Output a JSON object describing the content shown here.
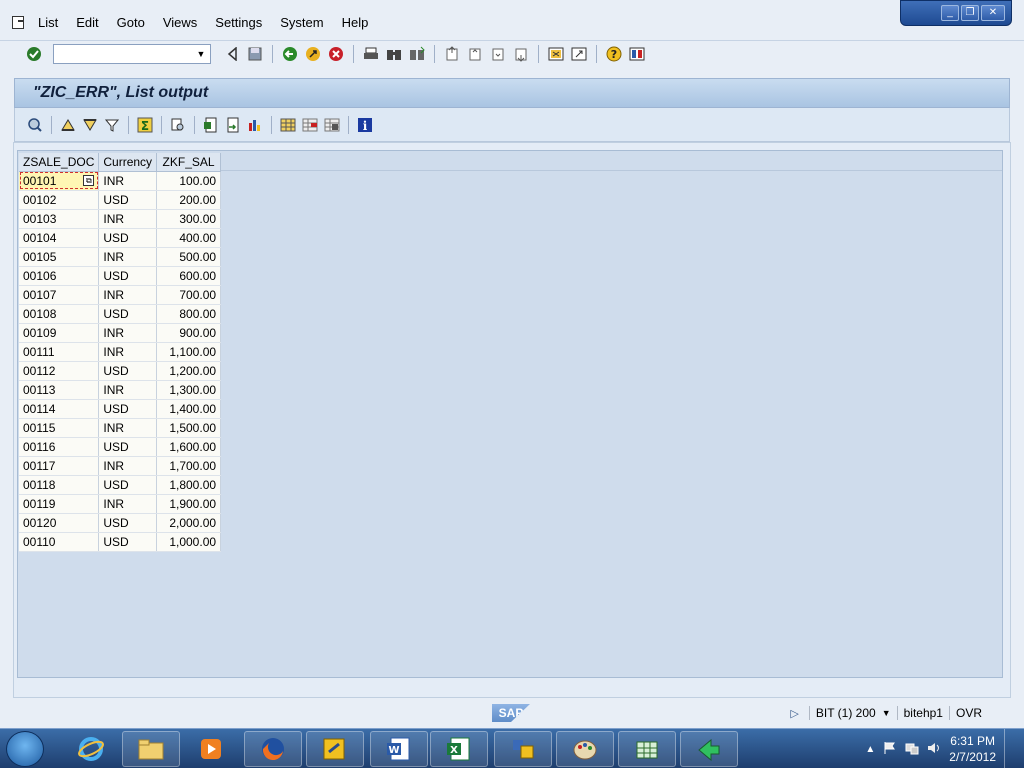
{
  "menu": {
    "items": [
      "List",
      "Edit",
      "Goto",
      "Views",
      "Settings",
      "System",
      "Help"
    ]
  },
  "window": {
    "minimize": "_",
    "restore": "❐",
    "close": "✕"
  },
  "command_field": {
    "value": ""
  },
  "title": "\"ZIC_ERR\", List output",
  "table": {
    "columns": [
      "ZSALE_DOC",
      "Currency",
      "ZKF_SAL"
    ],
    "rows": [
      [
        "00101",
        "INR",
        "100.00"
      ],
      [
        "00102",
        "USD",
        "200.00"
      ],
      [
        "00103",
        "INR",
        "300.00"
      ],
      [
        "00104",
        "USD",
        "400.00"
      ],
      [
        "00105",
        "INR",
        "500.00"
      ],
      [
        "00106",
        "USD",
        "600.00"
      ],
      [
        "00107",
        "INR",
        "700.00"
      ],
      [
        "00108",
        "USD",
        "800.00"
      ],
      [
        "00109",
        "INR",
        "900.00"
      ],
      [
        "00111",
        "INR",
        "1,100.00"
      ],
      [
        "00112",
        "USD",
        "1,200.00"
      ],
      [
        "00113",
        "INR",
        "1,300.00"
      ],
      [
        "00114",
        "USD",
        "1,400.00"
      ],
      [
        "00115",
        "INR",
        "1,500.00"
      ],
      [
        "00116",
        "USD",
        "1,600.00"
      ],
      [
        "00117",
        "INR",
        "1,700.00"
      ],
      [
        "00118",
        "USD",
        "1,800.00"
      ],
      [
        "00119",
        "INR",
        "1,900.00"
      ],
      [
        "00120",
        "USD",
        "2,000.00"
      ],
      [
        "00110",
        "USD",
        "1,000.00"
      ]
    ],
    "selected_row": 0
  },
  "status": {
    "logo": "SAP",
    "system": "BIT (1) 200",
    "server": "bitehp1",
    "mode": "OVR"
  },
  "taskbar": {
    "time": "6:31 PM",
    "date": "2/7/2012"
  },
  "colors": {
    "title_bg": "#b8cfe8",
    "content_bg": "#cfdcec",
    "selected_cell": "#fff6b4",
    "taskbar": "#2a5288"
  }
}
